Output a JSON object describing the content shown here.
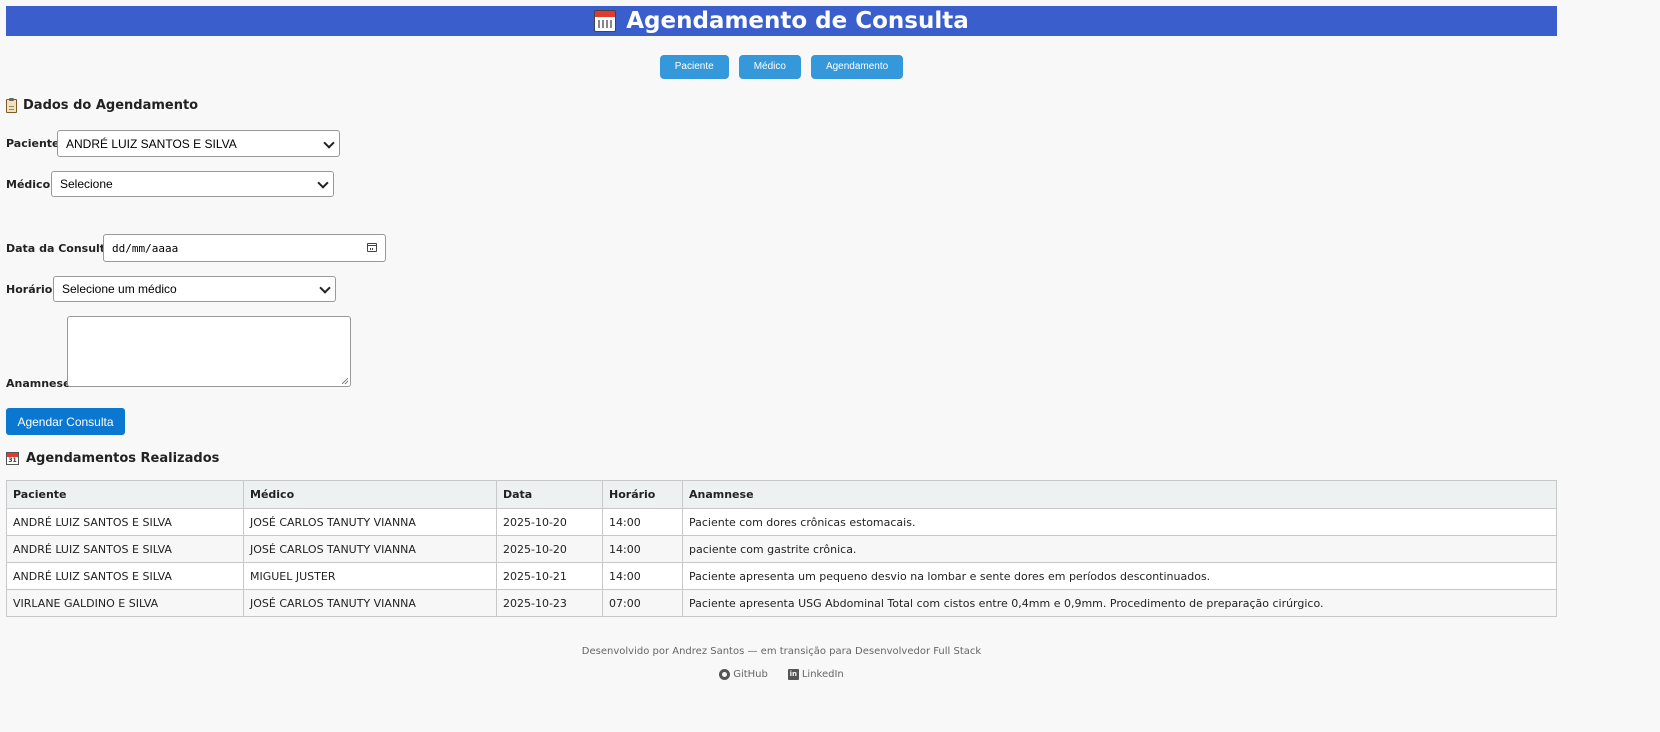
{
  "header": {
    "title": "Agendamento de Consulta"
  },
  "nav": {
    "paciente": "Paciente",
    "medico": "Médico",
    "agendamento": "Agendamento"
  },
  "form": {
    "section_title": "Dados do Agendamento",
    "paciente_label": "Paciente:",
    "paciente_value": "ANDRÉ LUIZ SANTOS E SILVA",
    "medico_label": "Médico:",
    "medico_value": "Selecione",
    "data_label": "Data da Consulta:",
    "data_placeholder": "dd/mm/aaaa",
    "horario_label": "Horário:",
    "horario_value": "Selecione um médico",
    "anamnese_label": "Anamnese:",
    "anamnese_value": "",
    "submit_label": "Agendar Consulta"
  },
  "table": {
    "section_title": "Agendamentos Realizados",
    "columns": [
      "Paciente",
      "Médico",
      "Data",
      "Horário",
      "Anamnese"
    ],
    "rows": [
      [
        "ANDRÉ LUIZ SANTOS E SILVA",
        "JOSÉ CARLOS TANUTY VIANNA",
        "2025-10-20",
        "14:00",
        "Paciente com dores crônicas estomacais."
      ],
      [
        "ANDRÉ LUIZ SANTOS E SILVA",
        "JOSÉ CARLOS TANUTY VIANNA",
        "2025-10-20",
        "14:00",
        "paciente com gastrite crônica."
      ],
      [
        "ANDRÉ LUIZ SANTOS E SILVA",
        "MIGUEL JUSTER",
        "2025-10-21",
        "14:00",
        "Paciente apresenta um pequeno desvio na lombar e sente dores em períodos descontinuados."
      ],
      [
        "VIRLANE GALDINO E SILVA",
        "JOSÉ CARLOS TANUTY VIANNA",
        "2025-10-23",
        "07:00",
        "Paciente apresenta USG Abdominal Total com cistos entre 0,4mm e 0,9mm. Procedimento de preparação cirúrgico."
      ]
    ]
  },
  "footer": {
    "text": "Desenvolvido por Andrez Santos — em transição para Desenvolvedor Full Stack",
    "github": "GitHub",
    "linkedin": "LinkedIn"
  },
  "colors": {
    "header_bg": "#3a5fcd",
    "nav_button": "#3498db",
    "primary_button": "#0a77d0"
  }
}
